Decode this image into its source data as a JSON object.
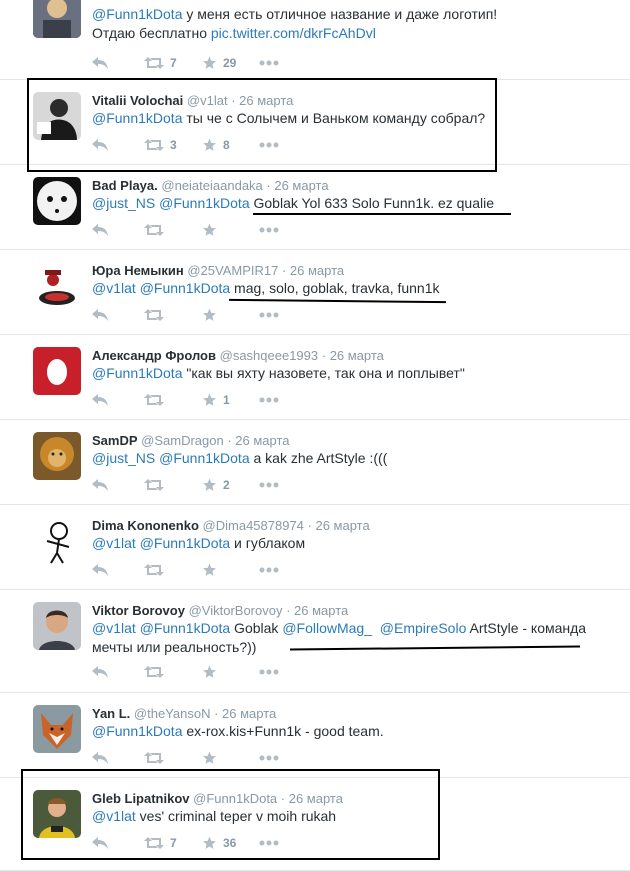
{
  "tweets": [
    {
      "name": "",
      "handle": "",
      "time": "",
      "text_html_parts": [],
      "line1": [
        {
          "t": "@Funn1kDota",
          "link": true
        },
        {
          "t": " у меня есть отличное название и даже логотип!",
          "link": false
        }
      ],
      "line2": [
        {
          "t": "Отдаю бесплатно ",
          "link": false
        },
        {
          "t": "pic.twitter.com/dkrFcAhDvl",
          "link": true
        }
      ],
      "retweets": "7",
      "favorites": "29"
    },
    {
      "name": "Vitalii Volochai",
      "handle": "@v1lat",
      "time": "26 марта",
      "line1": [
        {
          "t": "@Funn1kDota",
          "link": true
        },
        {
          "t": " ты че с Солычем и Ваньком команду собрал?",
          "link": false
        }
      ],
      "retweets": "3",
      "favorites": "8"
    },
    {
      "name": "Bad Playa.",
      "handle": "@neiateiaandaka",
      "time": "26 марта",
      "line1": [
        {
          "t": "@just_NS",
          "link": true
        },
        {
          "t": " ",
          "link": false
        },
        {
          "t": "@Funn1kDota",
          "link": true
        },
        {
          "t": " Goblak Yol 633 Solo Funn1k. ez qualie",
          "link": false
        }
      ],
      "retweets": "",
      "favorites": ""
    },
    {
      "name": "Юра Немыкин",
      "handle": "@25VAMPIR17",
      "time": "26 марта",
      "line1": [
        {
          "t": "@v1lat",
          "link": true
        },
        {
          "t": " ",
          "link": false
        },
        {
          "t": "@Funn1kDota",
          "link": true
        },
        {
          "t": " mag, solo, goblak, travka, funn1k",
          "link": false
        }
      ],
      "retweets": "",
      "favorites": ""
    },
    {
      "name": "Александр Фролов",
      "handle": "@sashqeee1993",
      "time": "26 марта",
      "line1": [
        {
          "t": "@Funn1kDota",
          "link": true
        },
        {
          "t": " \"как вы яхту назовете, так она и поплывет\"",
          "link": false
        }
      ],
      "retweets": "",
      "favorites": "1"
    },
    {
      "name": "SamDP",
      "handle": "@SamDragon",
      "time": "26 марта",
      "line1": [
        {
          "t": "@just_NS",
          "link": true
        },
        {
          "t": " ",
          "link": false
        },
        {
          "t": "@Funn1kDota",
          "link": true
        },
        {
          "t": " a kak zhe ArtStyle :(((",
          "link": false
        }
      ],
      "retweets": "",
      "favorites": "2"
    },
    {
      "name": "Dima Kononenko",
      "handle": "@Dima45878974",
      "time": "26 марта",
      "line1": [
        {
          "t": "@v1lat",
          "link": true
        },
        {
          "t": " ",
          "link": false
        },
        {
          "t": "@Funn1kDota",
          "link": true
        },
        {
          "t": " и гублаком",
          "link": false
        }
      ],
      "retweets": "",
      "favorites": ""
    },
    {
      "name": "Viktor Borovoy",
      "handle": "@ViktorBorovoy",
      "time": "26 марта",
      "line1": [
        {
          "t": "@v1lat",
          "link": true
        },
        {
          "t": " ",
          "link": false
        },
        {
          "t": "@Funn1kDota",
          "link": true
        },
        {
          "t": " Goblak ",
          "link": false
        },
        {
          "t": "@FollowMag_",
          "link": true
        },
        {
          "t": "  ",
          "link": false
        },
        {
          "t": "@EmpireSolo",
          "link": true
        },
        {
          "t": " ArtStyle - команда",
          "link": false
        }
      ],
      "line2": [
        {
          "t": "мечты или реальность?))",
          "link": false
        }
      ],
      "retweets": "",
      "favorites": ""
    },
    {
      "name": "Yan L.",
      "handle": "@theYansoN",
      "time": "26 марта",
      "line1": [
        {
          "t": "@Funn1kDota",
          "link": true
        },
        {
          "t": " ex-rox.kis+Funn1k - good team.",
          "link": false
        }
      ],
      "retweets": "",
      "favorites": ""
    },
    {
      "name": "Gleb Lipatnikov",
      "handle": "@Funn1kDota",
      "time": "26 марта",
      "line1": [
        {
          "t": "@v1lat",
          "link": true
        },
        {
          "t": " ves' criminal teper v moih rukah",
          "link": false
        }
      ],
      "retweets": "7",
      "favorites": "36"
    }
  ],
  "icons": {
    "reply": "reply-icon",
    "retweet": "retweet-icon",
    "favorite": "star-icon",
    "more": "more-icon"
  },
  "colors": {
    "link": "#2b7bb9",
    "muted": "#8899a6",
    "text": "#292f33"
  }
}
